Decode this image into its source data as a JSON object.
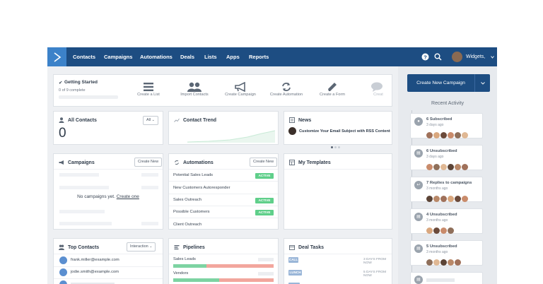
{
  "nav": {
    "items": [
      {
        "label": "Contacts"
      },
      {
        "label": "Campaigns"
      },
      {
        "label": "Automations"
      },
      {
        "label": "Deals"
      },
      {
        "label": "Lists"
      },
      {
        "label": "Apps"
      },
      {
        "label": "Reports"
      }
    ],
    "account_label": "Widgets,",
    "brand_color": "#1d4d82",
    "logo_color": "#3c82c9"
  },
  "getting_started": {
    "title": "Getting Started",
    "progress_text": "0 of 9 complete",
    "progress_fraction": 0,
    "items": [
      {
        "label": "Create a List",
        "icon": "list-icon"
      },
      {
        "label": "Import Contacts",
        "icon": "people-icon"
      },
      {
        "label": "Create Campaign",
        "icon": "megaphone-icon"
      },
      {
        "label": "Create Automation",
        "icon": "refresh-icon"
      },
      {
        "label": "Create a Form",
        "icon": "pencil-icon"
      },
      {
        "label": "Creat",
        "icon": "chat-icon"
      }
    ]
  },
  "all_contacts": {
    "title": "All Contacts",
    "count": "0",
    "filter": "All"
  },
  "contact_trend": {
    "title": "Contact Trend"
  },
  "news": {
    "title": "News",
    "headline": "Customize Your Email Subject with RSS Content",
    "page_count": 3,
    "active_page": 1
  },
  "campaigns": {
    "title": "Campaigns",
    "button": "Create New",
    "empty_text": "No campaigns yet.",
    "empty_link": "Create one"
  },
  "automations": {
    "title": "Automations",
    "button": "Create New",
    "rows": [
      {
        "name": "Potential Sales Leads",
        "badge": "ACTIVE"
      },
      {
        "name": "New Customers Autoresponder",
        "badge": ""
      },
      {
        "name": "Sales Outreach",
        "badge": "ACTIVE"
      },
      {
        "name": "Possible Customers",
        "badge": "ACTIVE"
      },
      {
        "name": "Client Outreach",
        "badge": ""
      }
    ]
  },
  "templates": {
    "title": "My Templates"
  },
  "top_contacts": {
    "title": "Top Contacts",
    "filter": "Interaction",
    "rows": [
      {
        "email": "frank.miller@example.com"
      },
      {
        "email": "jodie.smith@example.com"
      }
    ]
  },
  "pipelines": {
    "title": "Pipelines",
    "rows": [
      {
        "name": "Sales Leads",
        "green_fraction": 0.33
      },
      {
        "name": "Vendors",
        "green_fraction": 0.46
      }
    ]
  },
  "deal_tasks": {
    "title": "Deal Tasks",
    "rows": [
      {
        "badge": "CALL",
        "due": "3 DAYS FROM NOW",
        "color": "#9ab6d8"
      },
      {
        "badge": "LUNCH",
        "due": "5 DAYS FROM NOW",
        "color": "#9ab6d8"
      },
      {
        "badge": "",
        "due": "",
        "color": "#9ab6d8"
      }
    ]
  },
  "sidebar": {
    "create_button": "Create New Campaign",
    "heading": "Recent Activity",
    "activities": [
      {
        "title": "6 Subscribed",
        "time": "3 days ago",
        "icon": "person-icon",
        "faces": 6
      },
      {
        "title": "6 Unsubscribed",
        "time": "3 days ago",
        "icon": "mail-icon",
        "faces": 6
      },
      {
        "title": "7 Replies to campaigns",
        "time": "3 months ago",
        "icon": "reply-icon",
        "faces": 6
      },
      {
        "title": "4 Unsubscribed",
        "time": "3 months ago",
        "icon": "mail-icon",
        "faces": 4
      },
      {
        "title": "5 Unsubscribed",
        "time": "3 months ago",
        "icon": "mail-icon",
        "faces": 5
      }
    ]
  }
}
